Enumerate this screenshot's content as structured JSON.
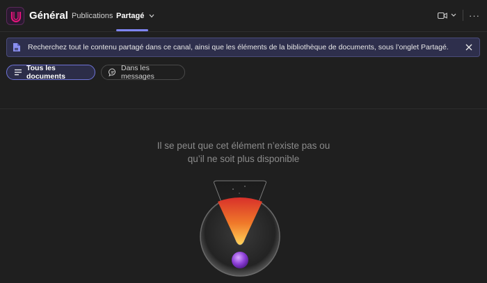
{
  "header": {
    "channel_title": "Général",
    "tabs": [
      {
        "label": "Publications"
      },
      {
        "label": "Partagé"
      }
    ],
    "more_label": "···"
  },
  "banner": {
    "text": "Recherchez tout le contenu partagé dans ce canal, ainsi que les éléments de la bibliothèque de documents, sous l’onglet Partagé."
  },
  "filters": {
    "all_documents": "Tous les documents",
    "in_messages": "Dans les messages"
  },
  "empty_state": {
    "line1": "Il se peut que cet élément n’existe pas ou",
    "line2": "qu’il ne soit plus disponible"
  },
  "colors": {
    "background": "#1f1f1f",
    "accent": "#7f85f5",
    "banner_bg": "#2e2f4c",
    "logo_magenta": "#e3147a"
  }
}
